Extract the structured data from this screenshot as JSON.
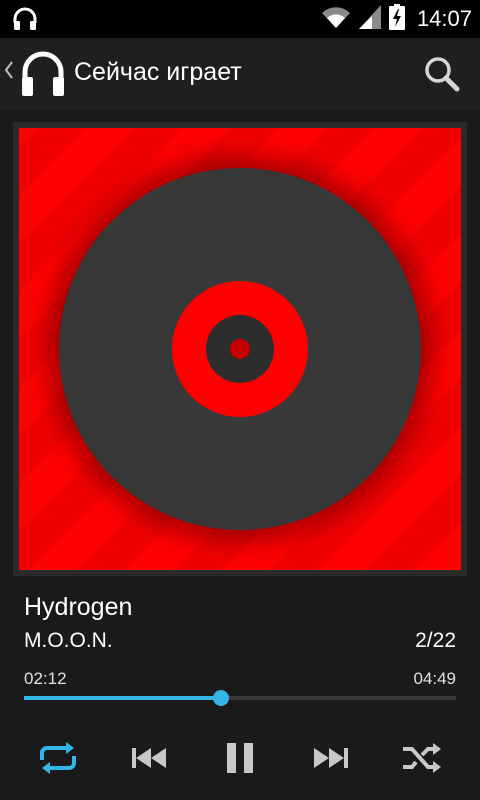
{
  "status_bar": {
    "time": "14:07",
    "icons": [
      "headphones-icon",
      "wifi-icon",
      "signal-icon",
      "battery-charging-icon"
    ]
  },
  "action_bar": {
    "title": "Сейчас играет",
    "icons": [
      "up-caret-icon",
      "headphones-app-icon",
      "search-icon"
    ]
  },
  "now_playing": {
    "title": "Hydrogen",
    "artist": "M.O.O.N.",
    "position_in_queue": "2/22",
    "elapsed": "02:12",
    "duration": "04:49",
    "progress_fraction": 0.457
  },
  "controls": {
    "repeat_active": true,
    "icons": [
      "repeat-icon",
      "previous-icon",
      "pause-icon",
      "next-icon",
      "shuffle-icon"
    ]
  },
  "colors": {
    "accent": "#33b5e5",
    "album_art_primary": "#ff0000",
    "disc": "#383838",
    "background": "#1a1a1a"
  }
}
